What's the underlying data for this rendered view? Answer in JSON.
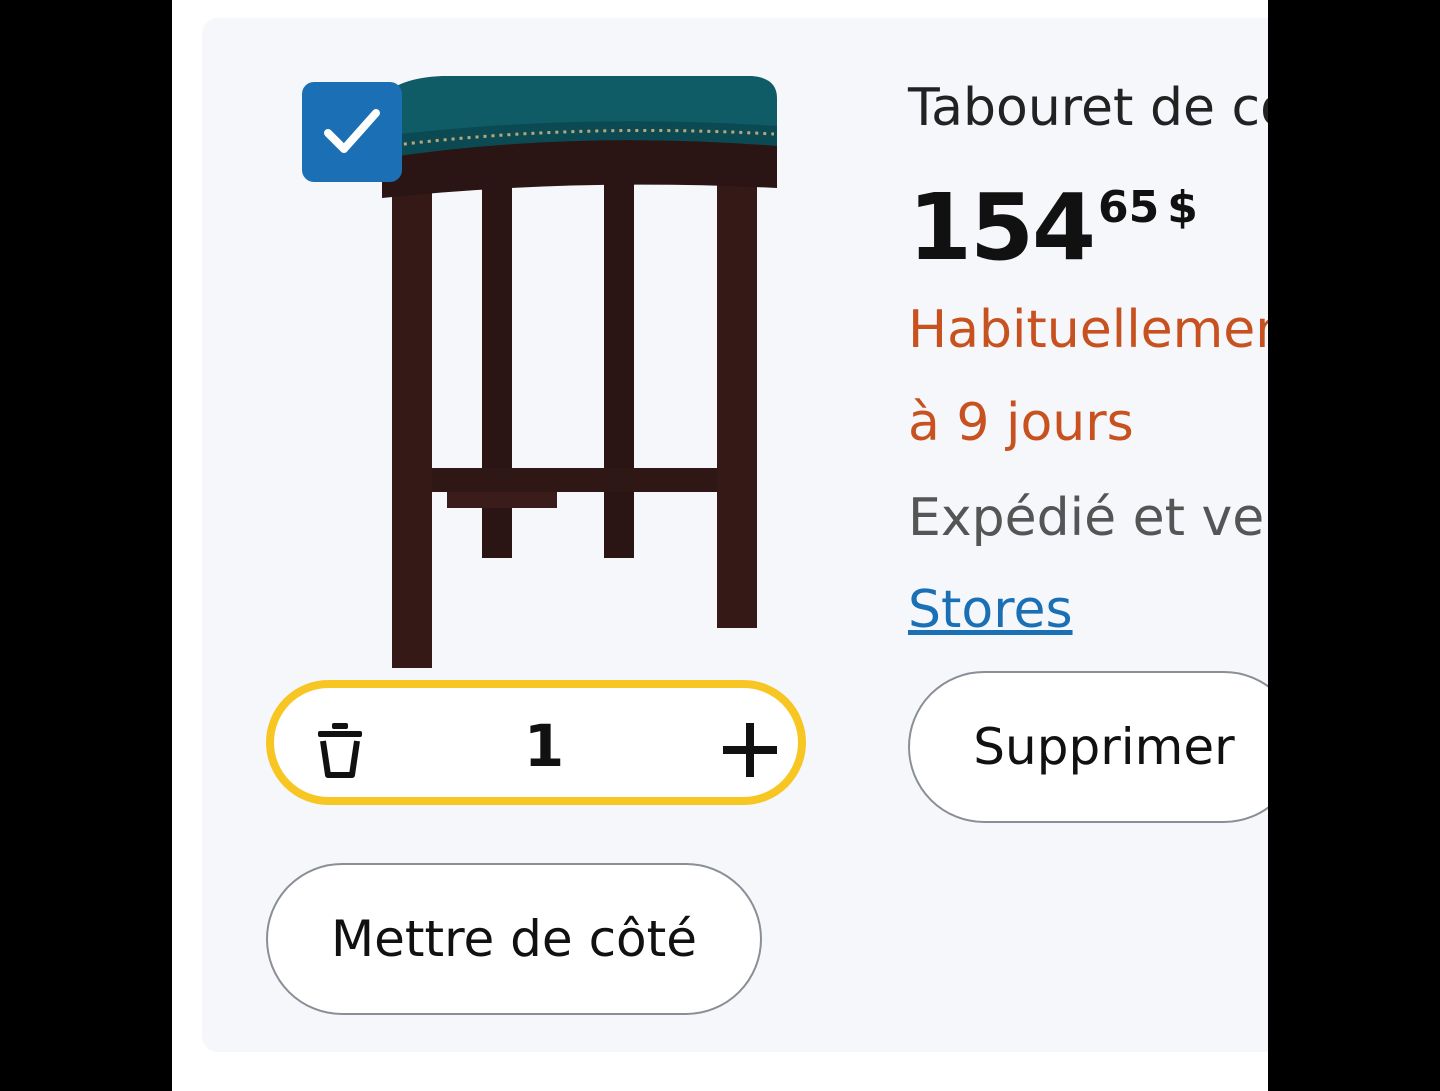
{
  "product": {
    "title": "Tabouret de co",
    "price_whole": "154",
    "price_cents": "65",
    "currency": "$",
    "availability_line1": "Habituellemen",
    "availability_line2": "à 9 jours",
    "seller_text": "Expédié et ven",
    "store_link": "Stores",
    "selected": true,
    "image_icon": "bar-stool-image"
  },
  "quantity": {
    "value": "1",
    "remove_icon": "trash-icon",
    "add_icon": "plus-icon"
  },
  "actions": {
    "delete_label": "Supprimer",
    "save_for_later_label": "Mettre de côté"
  },
  "colors": {
    "accent_blue": "#1a6fb5",
    "stepper_border": "#f7c623",
    "availability_orange": "#c7511f",
    "card_background": "#f5f7fa"
  }
}
